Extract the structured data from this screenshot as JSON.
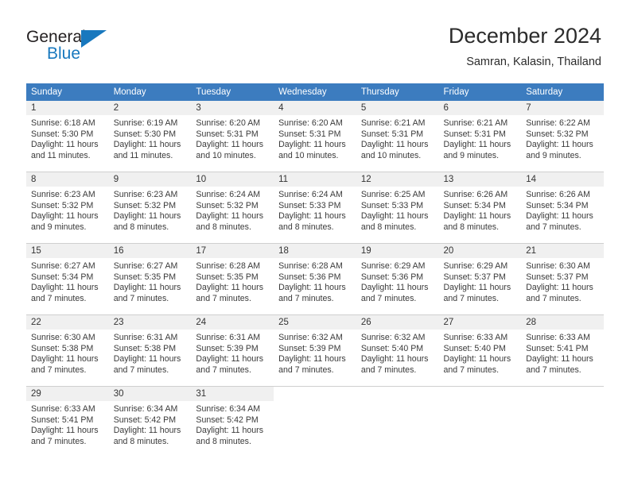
{
  "logo": {
    "word1": "General",
    "word2": "Blue",
    "brand_color": "#1878be",
    "triangle_icon": "triangle-icon"
  },
  "header": {
    "title": "December 2024",
    "subtitle": "Samran, Kalasin, Thailand"
  },
  "calendar": {
    "header_bg": "#3c7cbf",
    "daynum_bg": "#f0f0f0",
    "weekdays": [
      "Sunday",
      "Monday",
      "Tuesday",
      "Wednesday",
      "Thursday",
      "Friday",
      "Saturday"
    ],
    "weeks": [
      [
        {
          "day": "1",
          "sunrise": "Sunrise: 6:18 AM",
          "sunset": "Sunset: 5:30 PM",
          "daylight1": "Daylight: 11 hours",
          "daylight2": "and 11 minutes."
        },
        {
          "day": "2",
          "sunrise": "Sunrise: 6:19 AM",
          "sunset": "Sunset: 5:30 PM",
          "daylight1": "Daylight: 11 hours",
          "daylight2": "and 11 minutes."
        },
        {
          "day": "3",
          "sunrise": "Sunrise: 6:20 AM",
          "sunset": "Sunset: 5:31 PM",
          "daylight1": "Daylight: 11 hours",
          "daylight2": "and 10 minutes."
        },
        {
          "day": "4",
          "sunrise": "Sunrise: 6:20 AM",
          "sunset": "Sunset: 5:31 PM",
          "daylight1": "Daylight: 11 hours",
          "daylight2": "and 10 minutes."
        },
        {
          "day": "5",
          "sunrise": "Sunrise: 6:21 AM",
          "sunset": "Sunset: 5:31 PM",
          "daylight1": "Daylight: 11 hours",
          "daylight2": "and 10 minutes."
        },
        {
          "day": "6",
          "sunrise": "Sunrise: 6:21 AM",
          "sunset": "Sunset: 5:31 PM",
          "daylight1": "Daylight: 11 hours",
          "daylight2": "and 9 minutes."
        },
        {
          "day": "7",
          "sunrise": "Sunrise: 6:22 AM",
          "sunset": "Sunset: 5:32 PM",
          "daylight1": "Daylight: 11 hours",
          "daylight2": "and 9 minutes."
        }
      ],
      [
        {
          "day": "8",
          "sunrise": "Sunrise: 6:23 AM",
          "sunset": "Sunset: 5:32 PM",
          "daylight1": "Daylight: 11 hours",
          "daylight2": "and 9 minutes."
        },
        {
          "day": "9",
          "sunrise": "Sunrise: 6:23 AM",
          "sunset": "Sunset: 5:32 PM",
          "daylight1": "Daylight: 11 hours",
          "daylight2": "and 8 minutes."
        },
        {
          "day": "10",
          "sunrise": "Sunrise: 6:24 AM",
          "sunset": "Sunset: 5:32 PM",
          "daylight1": "Daylight: 11 hours",
          "daylight2": "and 8 minutes."
        },
        {
          "day": "11",
          "sunrise": "Sunrise: 6:24 AM",
          "sunset": "Sunset: 5:33 PM",
          "daylight1": "Daylight: 11 hours",
          "daylight2": "and 8 minutes."
        },
        {
          "day": "12",
          "sunrise": "Sunrise: 6:25 AM",
          "sunset": "Sunset: 5:33 PM",
          "daylight1": "Daylight: 11 hours",
          "daylight2": "and 8 minutes."
        },
        {
          "day": "13",
          "sunrise": "Sunrise: 6:26 AM",
          "sunset": "Sunset: 5:34 PM",
          "daylight1": "Daylight: 11 hours",
          "daylight2": "and 8 minutes."
        },
        {
          "day": "14",
          "sunrise": "Sunrise: 6:26 AM",
          "sunset": "Sunset: 5:34 PM",
          "daylight1": "Daylight: 11 hours",
          "daylight2": "and 7 minutes."
        }
      ],
      [
        {
          "day": "15",
          "sunrise": "Sunrise: 6:27 AM",
          "sunset": "Sunset: 5:34 PM",
          "daylight1": "Daylight: 11 hours",
          "daylight2": "and 7 minutes."
        },
        {
          "day": "16",
          "sunrise": "Sunrise: 6:27 AM",
          "sunset": "Sunset: 5:35 PM",
          "daylight1": "Daylight: 11 hours",
          "daylight2": "and 7 minutes."
        },
        {
          "day": "17",
          "sunrise": "Sunrise: 6:28 AM",
          "sunset": "Sunset: 5:35 PM",
          "daylight1": "Daylight: 11 hours",
          "daylight2": "and 7 minutes."
        },
        {
          "day": "18",
          "sunrise": "Sunrise: 6:28 AM",
          "sunset": "Sunset: 5:36 PM",
          "daylight1": "Daylight: 11 hours",
          "daylight2": "and 7 minutes."
        },
        {
          "day": "19",
          "sunrise": "Sunrise: 6:29 AM",
          "sunset": "Sunset: 5:36 PM",
          "daylight1": "Daylight: 11 hours",
          "daylight2": "and 7 minutes."
        },
        {
          "day": "20",
          "sunrise": "Sunrise: 6:29 AM",
          "sunset": "Sunset: 5:37 PM",
          "daylight1": "Daylight: 11 hours",
          "daylight2": "and 7 minutes."
        },
        {
          "day": "21",
          "sunrise": "Sunrise: 6:30 AM",
          "sunset": "Sunset: 5:37 PM",
          "daylight1": "Daylight: 11 hours",
          "daylight2": "and 7 minutes."
        }
      ],
      [
        {
          "day": "22",
          "sunrise": "Sunrise: 6:30 AM",
          "sunset": "Sunset: 5:38 PM",
          "daylight1": "Daylight: 11 hours",
          "daylight2": "and 7 minutes."
        },
        {
          "day": "23",
          "sunrise": "Sunrise: 6:31 AM",
          "sunset": "Sunset: 5:38 PM",
          "daylight1": "Daylight: 11 hours",
          "daylight2": "and 7 minutes."
        },
        {
          "day": "24",
          "sunrise": "Sunrise: 6:31 AM",
          "sunset": "Sunset: 5:39 PM",
          "daylight1": "Daylight: 11 hours",
          "daylight2": "and 7 minutes."
        },
        {
          "day": "25",
          "sunrise": "Sunrise: 6:32 AM",
          "sunset": "Sunset: 5:39 PM",
          "daylight1": "Daylight: 11 hours",
          "daylight2": "and 7 minutes."
        },
        {
          "day": "26",
          "sunrise": "Sunrise: 6:32 AM",
          "sunset": "Sunset: 5:40 PM",
          "daylight1": "Daylight: 11 hours",
          "daylight2": "and 7 minutes."
        },
        {
          "day": "27",
          "sunrise": "Sunrise: 6:33 AM",
          "sunset": "Sunset: 5:40 PM",
          "daylight1": "Daylight: 11 hours",
          "daylight2": "and 7 minutes."
        },
        {
          "day": "28",
          "sunrise": "Sunrise: 6:33 AM",
          "sunset": "Sunset: 5:41 PM",
          "daylight1": "Daylight: 11 hours",
          "daylight2": "and 7 minutes."
        }
      ],
      [
        {
          "day": "29",
          "sunrise": "Sunrise: 6:33 AM",
          "sunset": "Sunset: 5:41 PM",
          "daylight1": "Daylight: 11 hours",
          "daylight2": "and 7 minutes."
        },
        {
          "day": "30",
          "sunrise": "Sunrise: 6:34 AM",
          "sunset": "Sunset: 5:42 PM",
          "daylight1": "Daylight: 11 hours",
          "daylight2": "and 8 minutes."
        },
        {
          "day": "31",
          "sunrise": "Sunrise: 6:34 AM",
          "sunset": "Sunset: 5:42 PM",
          "daylight1": "Daylight: 11 hours",
          "daylight2": "and 8 minutes."
        },
        {
          "day": "",
          "sunrise": "",
          "sunset": "",
          "daylight1": "",
          "daylight2": ""
        },
        {
          "day": "",
          "sunrise": "",
          "sunset": "",
          "daylight1": "",
          "daylight2": ""
        },
        {
          "day": "",
          "sunrise": "",
          "sunset": "",
          "daylight1": "",
          "daylight2": ""
        },
        {
          "day": "",
          "sunrise": "",
          "sunset": "",
          "daylight1": "",
          "daylight2": ""
        }
      ]
    ]
  }
}
